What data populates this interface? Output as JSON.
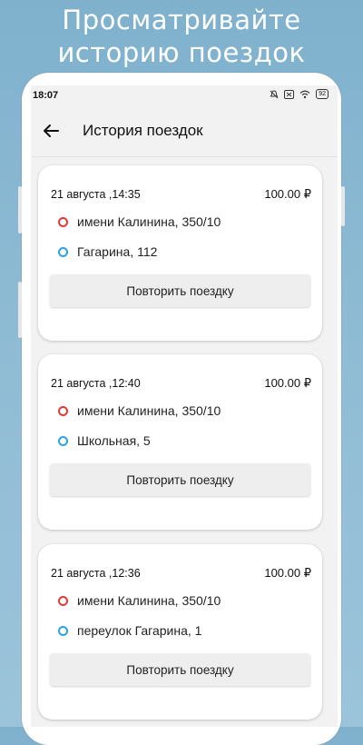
{
  "promo": {
    "line1": "Просматривайте",
    "line2": "историю поездок"
  },
  "status_bar": {
    "time": "18:07",
    "icons": [
      "mute-bell-icon",
      "sim-icon",
      "wifi-icon"
    ],
    "battery": "92"
  },
  "appbar": {
    "back_icon": "arrow-left-icon",
    "title": "История поездок"
  },
  "trips": [
    {
      "date": "21 августа ,14:35",
      "price": "100.00 ₽",
      "from": "имени Калинина, 350/10",
      "to": "Гагарина, 112",
      "repeat_label": "Повторить поездку"
    },
    {
      "date": "21 августа ,12:40",
      "price": "100.00 ₽",
      "from": "имени Калинина, 350/10",
      "to": "Школьная, 5",
      "repeat_label": "Повторить поездку"
    },
    {
      "date": "21 августа ,12:36",
      "price": "100.00 ₽",
      "from": "имени Калинина, 350/10",
      "to": "переулок Гагарина, 1",
      "repeat_label": "Повторить поездку"
    }
  ],
  "colors": {
    "background": "#8bb8d2",
    "from_marker": "#e53935",
    "to_marker": "#29a3e6"
  }
}
